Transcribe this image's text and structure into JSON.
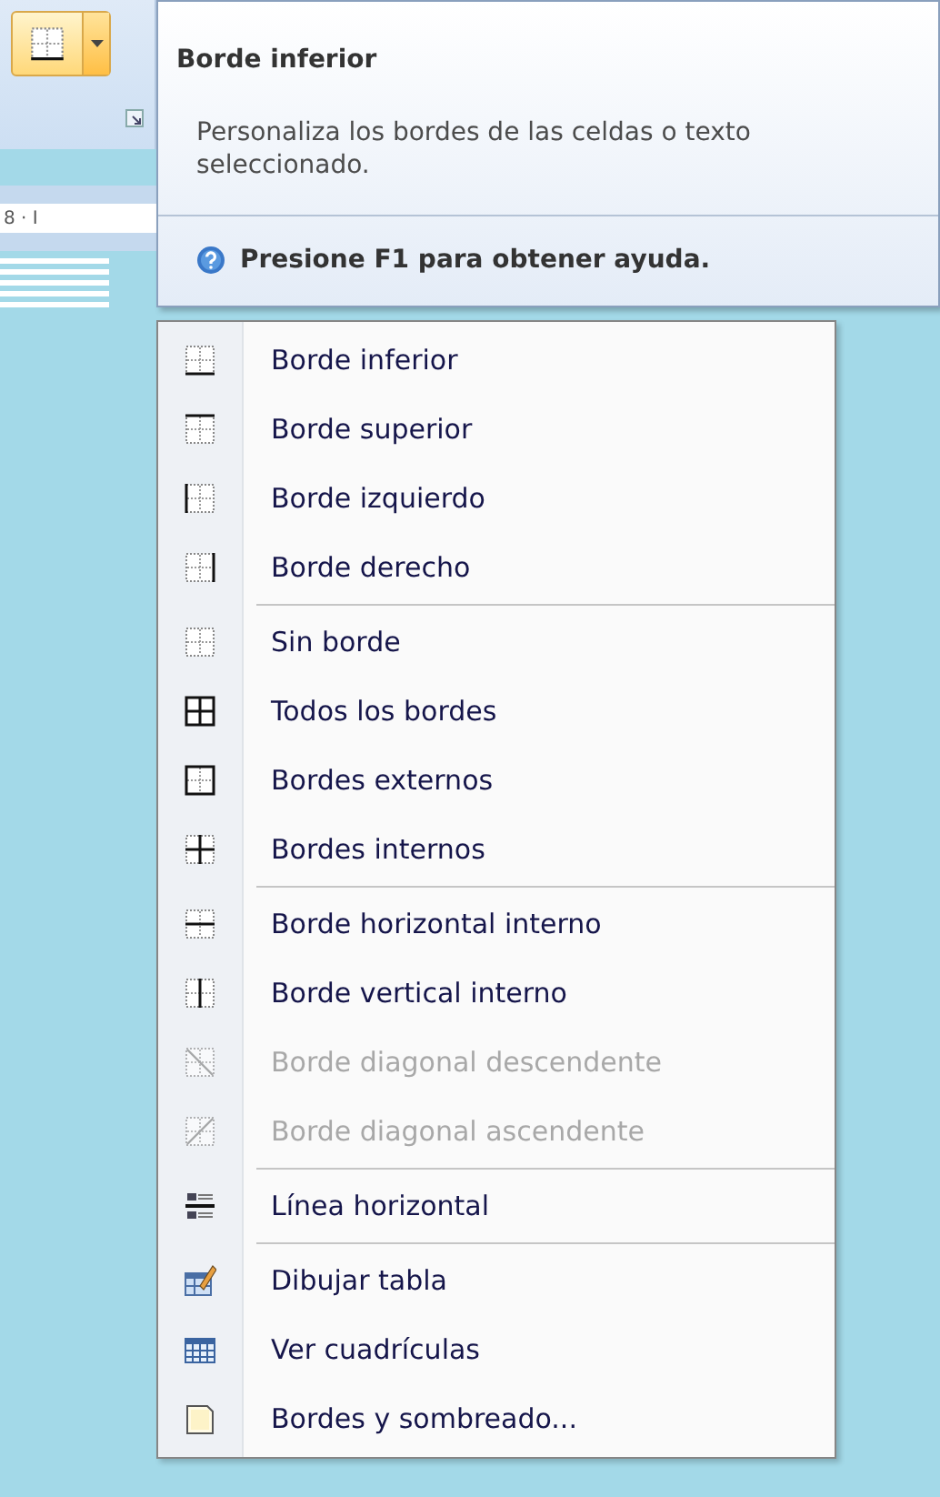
{
  "ribbon": {
    "ruler_label": "8 · I"
  },
  "tooltip": {
    "title": "Borde inferior",
    "description": "Personaliza los bordes de las celdas o texto seleccionado.",
    "help": "Presione F1 para obtener ayuda."
  },
  "menu": {
    "groups": [
      [
        {
          "label": "Borde inferior",
          "disabled": false
        },
        {
          "label": "Borde superior",
          "disabled": false
        },
        {
          "label": "Borde izquierdo",
          "disabled": false
        },
        {
          "label": "Borde derecho",
          "disabled": false
        }
      ],
      [
        {
          "label": "Sin borde",
          "disabled": false
        },
        {
          "label": "Todos los bordes",
          "disabled": false
        },
        {
          "label": "Bordes externos",
          "disabled": false
        },
        {
          "label": "Bordes internos",
          "disabled": false
        }
      ],
      [
        {
          "label": "Borde horizontal interno",
          "disabled": false
        },
        {
          "label": "Borde vertical interno",
          "disabled": false
        },
        {
          "label": "Borde diagonal descendente",
          "disabled": true
        },
        {
          "label": "Borde diagonal ascendente",
          "disabled": true
        }
      ],
      [
        {
          "label": "Línea horizontal",
          "disabled": false
        }
      ],
      [
        {
          "label": "Dibujar tabla",
          "disabled": false
        },
        {
          "label": "Ver cuadrículas",
          "disabled": false
        },
        {
          "label": "Bordes y sombreado...",
          "disabled": false
        }
      ]
    ]
  }
}
